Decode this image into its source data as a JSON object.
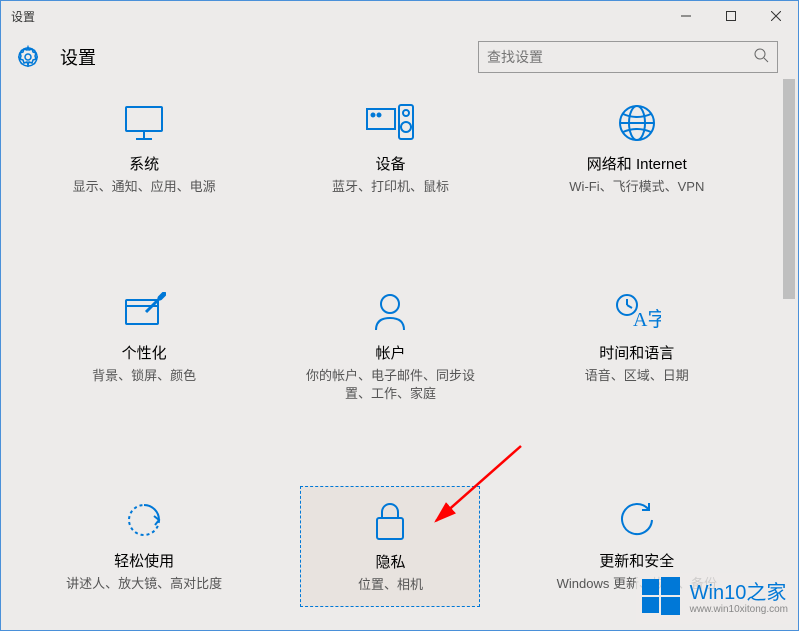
{
  "window": {
    "title": "设置"
  },
  "header": {
    "title": "设置"
  },
  "search": {
    "placeholder": "查找设置"
  },
  "tiles": [
    {
      "title": "系统",
      "desc": "显示、通知、应用、电源"
    },
    {
      "title": "设备",
      "desc": "蓝牙、打印机、鼠标"
    },
    {
      "title": "网络和 Internet",
      "desc": "Wi-Fi、飞行模式、VPN"
    },
    {
      "title": "个性化",
      "desc": "背景、锁屏、颜色"
    },
    {
      "title": "帐户",
      "desc": "你的帐户、电子邮件、同步设置、工作、家庭"
    },
    {
      "title": "时间和语言",
      "desc": "语音、区域、日期"
    },
    {
      "title": "轻松使用",
      "desc": "讲述人、放大镜、高对比度"
    },
    {
      "title": "隐私",
      "desc": "位置、相机"
    },
    {
      "title": "更新和安全",
      "desc": "Windows 更新、恢复、备份"
    }
  ],
  "watermark": {
    "main": "Win10之家",
    "sub": "www.win10xitong.com"
  }
}
